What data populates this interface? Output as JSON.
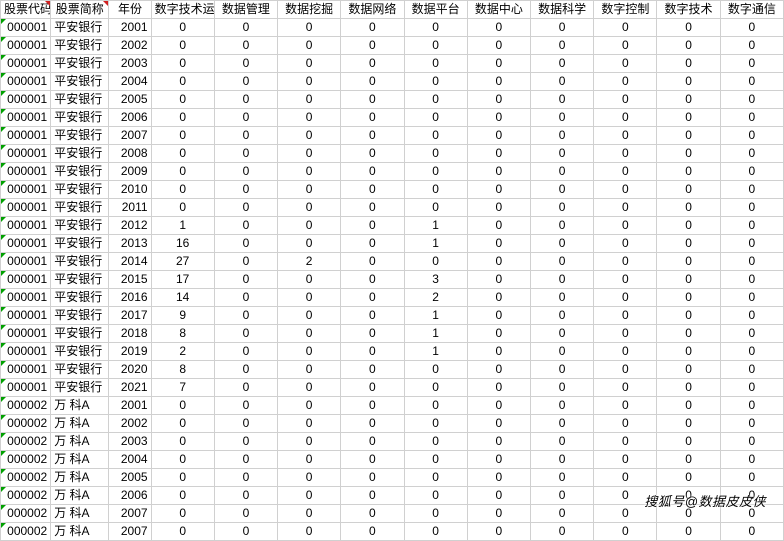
{
  "headers": [
    "股票代码",
    "股票简称",
    "年份",
    "数字技术运用",
    "数据管理",
    "数据挖掘",
    "数据网络",
    "数据平台",
    "数据中心",
    "数据科学",
    "数字控制",
    "数字技术",
    "数字通信"
  ],
  "rows": [
    [
      "000001",
      "平安银行",
      "2001",
      0,
      0,
      0,
      0,
      0,
      0,
      0,
      0,
      0,
      0
    ],
    [
      "000001",
      "平安银行",
      "2002",
      0,
      0,
      0,
      0,
      0,
      0,
      0,
      0,
      0,
      0
    ],
    [
      "000001",
      "平安银行",
      "2003",
      0,
      0,
      0,
      0,
      0,
      0,
      0,
      0,
      0,
      0
    ],
    [
      "000001",
      "平安银行",
      "2004",
      0,
      0,
      0,
      0,
      0,
      0,
      0,
      0,
      0,
      0
    ],
    [
      "000001",
      "平安银行",
      "2005",
      0,
      0,
      0,
      0,
      0,
      0,
      0,
      0,
      0,
      0
    ],
    [
      "000001",
      "平安银行",
      "2006",
      0,
      0,
      0,
      0,
      0,
      0,
      0,
      0,
      0,
      0
    ],
    [
      "000001",
      "平安银行",
      "2007",
      0,
      0,
      0,
      0,
      0,
      0,
      0,
      0,
      0,
      0
    ],
    [
      "000001",
      "平安银行",
      "2008",
      0,
      0,
      0,
      0,
      0,
      0,
      0,
      0,
      0,
      0
    ],
    [
      "000001",
      "平安银行",
      "2009",
      0,
      0,
      0,
      0,
      0,
      0,
      0,
      0,
      0,
      0
    ],
    [
      "000001",
      "平安银行",
      "2010",
      0,
      0,
      0,
      0,
      0,
      0,
      0,
      0,
      0,
      0
    ],
    [
      "000001",
      "平安银行",
      "2011",
      0,
      0,
      0,
      0,
      0,
      0,
      0,
      0,
      0,
      0
    ],
    [
      "000001",
      "平安银行",
      "2012",
      1,
      0,
      0,
      0,
      1,
      0,
      0,
      0,
      0,
      0
    ],
    [
      "000001",
      "平安银行",
      "2013",
      16,
      0,
      0,
      0,
      1,
      0,
      0,
      0,
      0,
      0
    ],
    [
      "000001",
      "平安银行",
      "2014",
      27,
      0,
      2,
      0,
      0,
      0,
      0,
      0,
      0,
      0
    ],
    [
      "000001",
      "平安银行",
      "2015",
      17,
      0,
      0,
      0,
      3,
      0,
      0,
      0,
      0,
      0
    ],
    [
      "000001",
      "平安银行",
      "2016",
      14,
      0,
      0,
      0,
      2,
      0,
      0,
      0,
      0,
      0
    ],
    [
      "000001",
      "平安银行",
      "2017",
      9,
      0,
      0,
      0,
      1,
      0,
      0,
      0,
      0,
      0
    ],
    [
      "000001",
      "平安银行",
      "2018",
      8,
      0,
      0,
      0,
      1,
      0,
      0,
      0,
      0,
      0
    ],
    [
      "000001",
      "平安银行",
      "2019",
      2,
      0,
      0,
      0,
      1,
      0,
      0,
      0,
      0,
      0
    ],
    [
      "000001",
      "平安银行",
      "2020",
      8,
      0,
      0,
      0,
      0,
      0,
      0,
      0,
      0,
      0
    ],
    [
      "000001",
      "平安银行",
      "2021",
      7,
      0,
      0,
      0,
      0,
      0,
      0,
      0,
      0,
      0
    ],
    [
      "000002",
      "万  科A",
      "2001",
      0,
      0,
      0,
      0,
      0,
      0,
      0,
      0,
      0,
      0
    ],
    [
      "000002",
      "万  科A",
      "2002",
      0,
      0,
      0,
      0,
      0,
      0,
      0,
      0,
      0,
      0
    ],
    [
      "000002",
      "万  科A",
      "2003",
      0,
      0,
      0,
      0,
      0,
      0,
      0,
      0,
      0,
      0
    ],
    [
      "000002",
      "万  科A",
      "2004",
      0,
      0,
      0,
      0,
      0,
      0,
      0,
      0,
      0,
      0
    ],
    [
      "000002",
      "万  科A",
      "2005",
      0,
      0,
      0,
      0,
      0,
      0,
      0,
      0,
      0,
      0
    ],
    [
      "000002",
      "万  科A",
      "2006",
      0,
      0,
      0,
      0,
      0,
      0,
      0,
      0,
      0,
      0
    ],
    [
      "000002",
      "万  科A",
      "2007",
      0,
      0,
      0,
      0,
      0,
      0,
      0,
      0,
      0,
      0
    ],
    [
      "000002",
      "万  科A",
      "2007",
      0,
      0,
      0,
      0,
      0,
      0,
      0,
      0,
      0,
      0
    ]
  ],
  "watermark": "搜狐号@数据皮皮侠"
}
